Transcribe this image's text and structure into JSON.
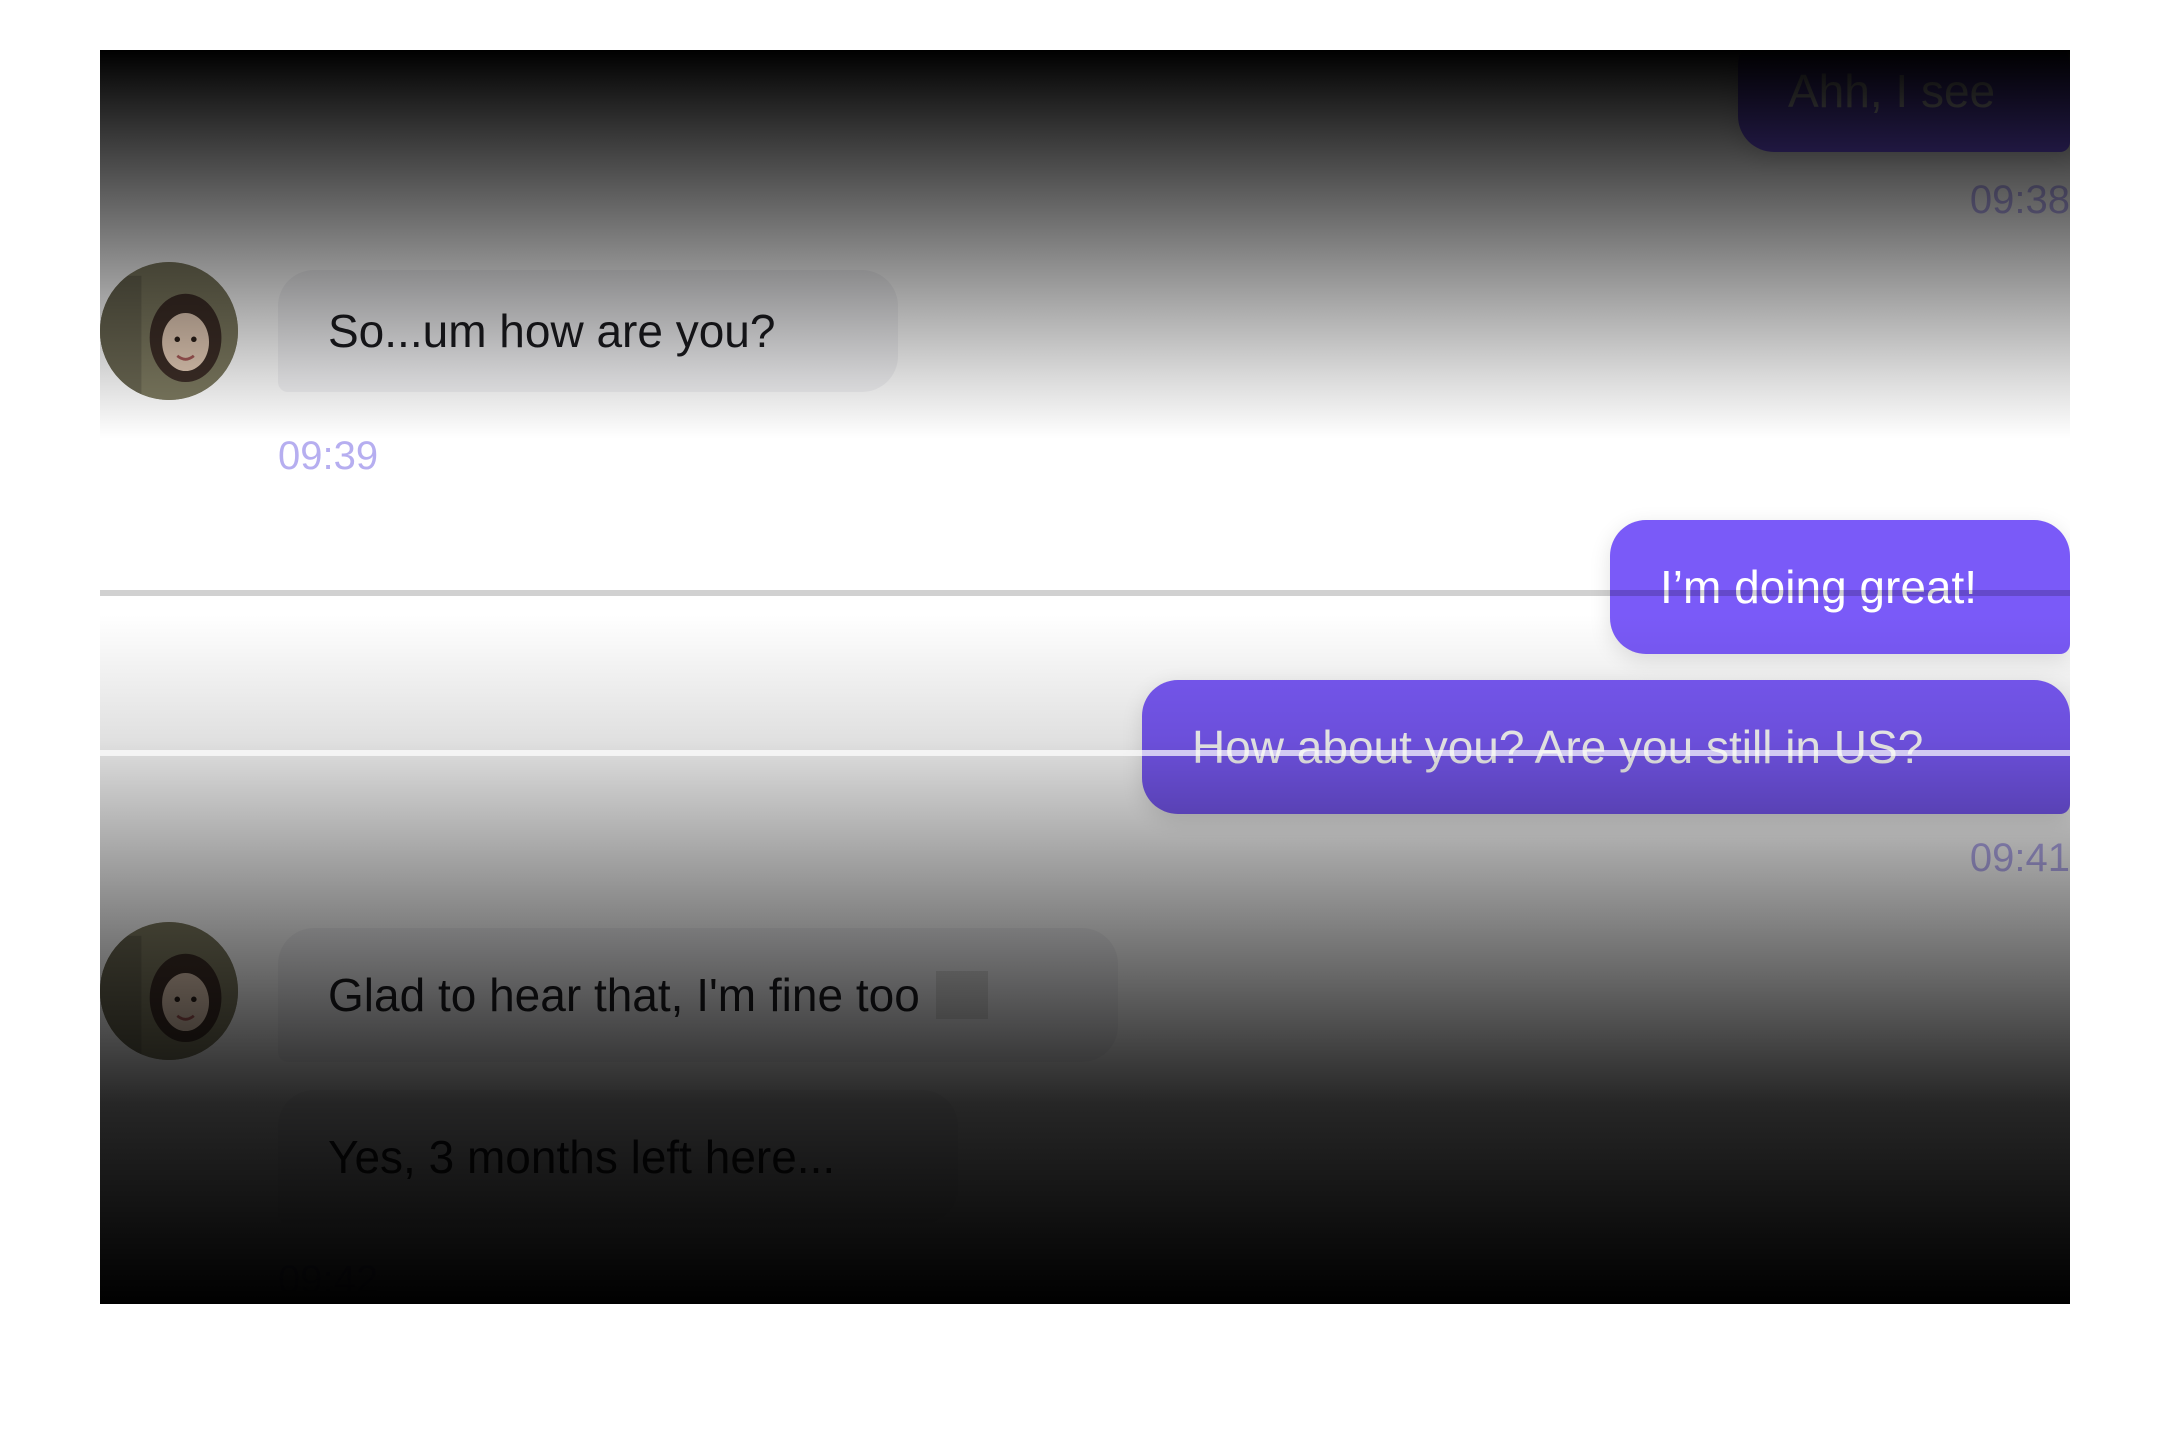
{
  "messages": {
    "m1": {
      "text": "Ahh, I see",
      "time": "09:38"
    },
    "m2": {
      "text": "So...um how are you?",
      "time": "09:39"
    },
    "m3": {
      "text": "I’m doing great!"
    },
    "m4": {
      "text": "How about you? Are you still in US?",
      "time": "09:41"
    },
    "m5": {
      "text": "Glad to hear that, I'm fine too"
    },
    "m6": {
      "text": "Yes, 3 months left here...",
      "time": "09:42"
    }
  },
  "colors": {
    "outgoing_bubble": "#7a5af8",
    "incoming_bubble": "#f3f3f5",
    "timestamp": "#b6aef0"
  },
  "icons": {
    "avatar": "contact-avatar-photo"
  }
}
